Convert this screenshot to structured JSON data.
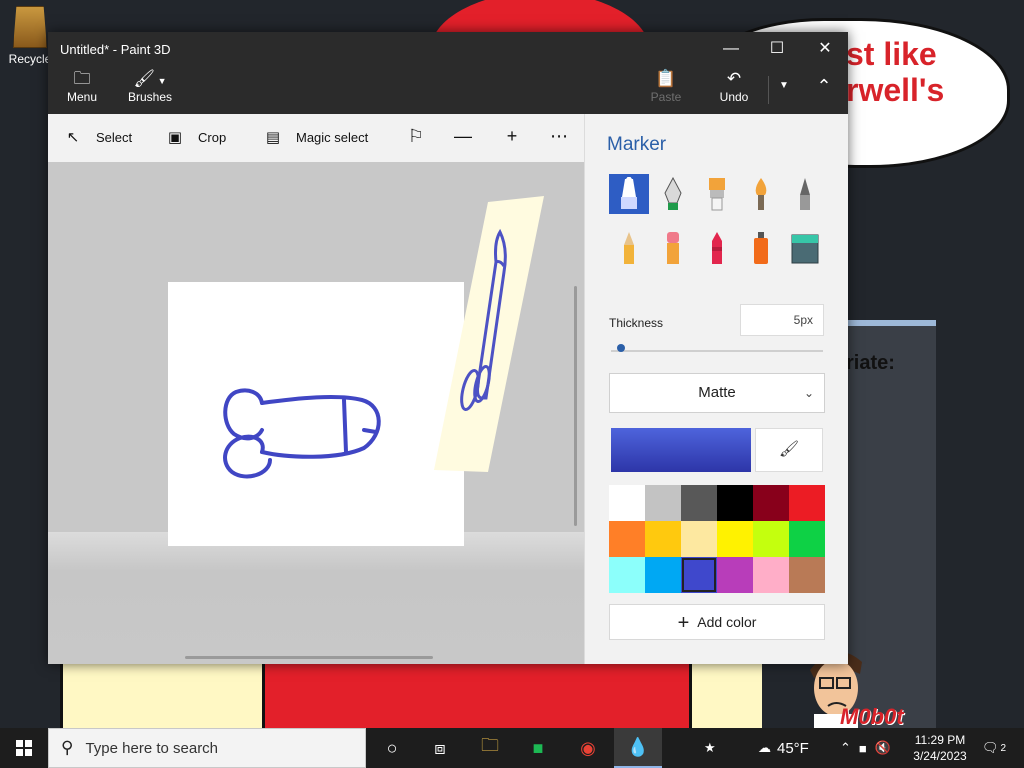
{
  "desktop": {
    "recycle_label": "Recycle",
    "bubble_lines": [
      "st like",
      "rwell's"
    ],
    "panel_text": "riate:",
    "watermark": "M0b0t"
  },
  "window": {
    "title": "Untitled* - Paint 3D",
    "ribbon": {
      "menu_label": "Menu",
      "brushes_label": "Brushes",
      "paste_label": "Paste",
      "undo_label": "Undo"
    },
    "toolbar": {
      "select_label": "Select",
      "crop_label": "Crop",
      "magic_select_label": "Magic select"
    }
  },
  "panel": {
    "title": "Marker",
    "brushes": [
      "marker",
      "calligraphy-pen",
      "oil-brush",
      "watercolor",
      "pixel-pen",
      "pencil",
      "eraser",
      "crayon",
      "spray-can",
      "fill"
    ],
    "thickness_label": "Thickness",
    "thickness_value": "5px",
    "thickness_level": 0.03,
    "finish_value": "Matte",
    "current_color": "#3d46c7",
    "palette": [
      "#ffffff",
      "#c3c3c3",
      "#585858",
      "#000000",
      "#88001b",
      "#ec1c24",
      "#ff7f27",
      "#ffc90e",
      "#fde8a0",
      "#fff200",
      "#c4ff0e",
      "#0ed145",
      "#8cfffb",
      "#00a8f3",
      "#3f48cc",
      "#b83dba",
      "#ffaec8",
      "#b97a56"
    ],
    "selected_swatch": 14,
    "add_color_label": "Add color"
  },
  "taskbar": {
    "search_placeholder": "Type here to search",
    "weather": "45°F",
    "time": "11:29 PM",
    "date": "3/24/2023",
    "notification_count": "2"
  }
}
